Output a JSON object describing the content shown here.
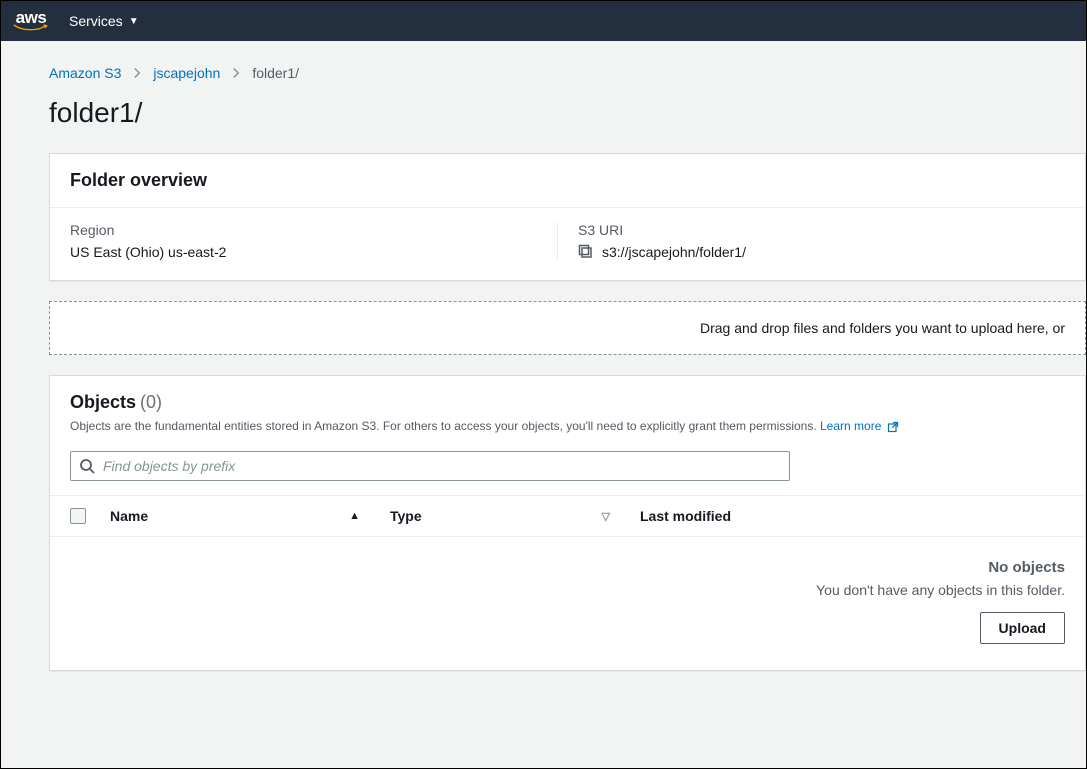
{
  "nav": {
    "services_label": "Services"
  },
  "breadcrumb": {
    "root": "Amazon S3",
    "bucket": "jscapejohn",
    "current": "folder1/"
  },
  "page_title": "folder1/",
  "overview": {
    "heading": "Folder overview",
    "region_label": "Region",
    "region_value": "US East (Ohio) us-east-2",
    "uri_label": "S3 URI",
    "uri_value": "s3://jscapejohn/folder1/"
  },
  "dropzone_text": "Drag and drop files and folders you want to upload here, or",
  "objects": {
    "heading": "Objects",
    "count_display": "(0)",
    "description": "Objects are the fundamental entities stored in Amazon S3. For others to access your objects, you'll need to explicitly grant them permissions. ",
    "learn_more": "Learn more",
    "search_placeholder": "Find objects by prefix",
    "columns": {
      "name": "Name",
      "type": "Type",
      "last_modified": "Last modified"
    },
    "empty_title": "No objects",
    "empty_subtitle": "You don't have any objects in this folder.",
    "upload_button": "Upload"
  }
}
